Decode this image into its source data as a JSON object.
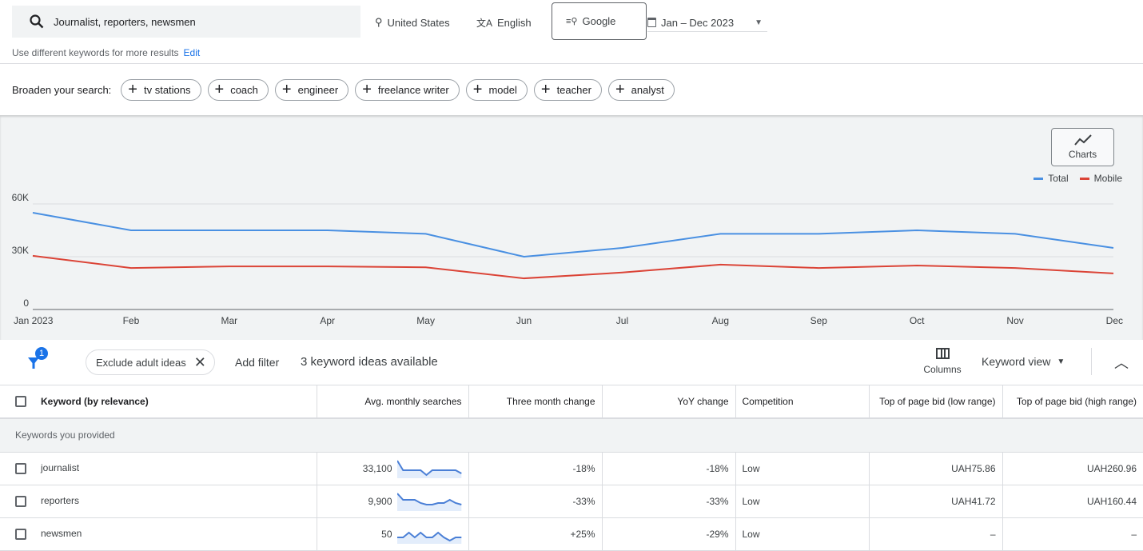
{
  "search": {
    "query": "Journalist, reporters, newsmen",
    "icon": "search-icon"
  },
  "location": "United States",
  "language": "English",
  "network": "Google",
  "date_range": "Jan – Dec 2023",
  "hint": "Use different keywords for more results",
  "edit": "Edit",
  "broaden": {
    "label": "Broaden your search:",
    "chips": [
      "tv stations",
      "coach",
      "engineer",
      "freelance writer",
      "model",
      "teacher",
      "analyst"
    ]
  },
  "charts_button": "Charts",
  "chart_data": {
    "type": "line",
    "categories": [
      "Jan 2023",
      "Feb",
      "Mar",
      "Apr",
      "May",
      "Jun",
      "Jul",
      "Aug",
      "Sep",
      "Oct",
      "Nov",
      "Dec"
    ],
    "yticks": [
      "0",
      "30K",
      "60K"
    ],
    "ylim": [
      0,
      60000
    ],
    "grid": true,
    "legend": "top-right",
    "series": [
      {
        "name": "Total",
        "color": "#4a90e2",
        "values": [
          55000,
          45000,
          45000,
          45000,
          43000,
          30000,
          35000,
          43000,
          43000,
          45000,
          43000,
          35000
        ]
      },
      {
        "name": "Mobile",
        "color": "#db4437",
        "values": [
          30500,
          23600,
          24500,
          24500,
          24000,
          17700,
          21000,
          25500,
          23600,
          25000,
          23600,
          20500
        ]
      }
    ]
  },
  "filters": {
    "badge": "1",
    "chip": "Exclude adult ideas",
    "add_filter": "Add filter",
    "count": "3 keyword ideas available",
    "columns": "Columns",
    "view": "Keyword view"
  },
  "table": {
    "headers": [
      "Keyword (by relevance)",
      "Avg. monthly searches",
      "Three month change",
      "YoY change",
      "Competition",
      "Top of page bid (low range)",
      "Top of page bid (high range)"
    ],
    "group": "Keywords you provided",
    "rows": [
      {
        "keyword": "journalist",
        "searches": "33,100",
        "three": "-18%",
        "yoy": "-18%",
        "comp": "Low",
        "low": "UAH75.86",
        "high": "UAH260.96",
        "trend": [
          10,
          4,
          4,
          4,
          4,
          1,
          4,
          4,
          4,
          4,
          4,
          2
        ]
      },
      {
        "keyword": "reporters",
        "searches": "9,900",
        "three": "-33%",
        "yoy": "-33%",
        "comp": "Low",
        "low": "UAH41.72",
        "high": "UAH160.44",
        "trend": [
          10,
          6,
          6,
          6,
          4,
          3,
          3,
          4,
          4,
          6,
          4,
          3
        ]
      },
      {
        "keyword": "newsmen",
        "searches": "50",
        "three": "+25%",
        "yoy": "-29%",
        "comp": "Low",
        "low": "–",
        "high": "–",
        "trend": [
          3,
          3,
          6,
          3,
          6,
          3,
          3,
          6,
          3,
          1,
          3,
          3
        ]
      }
    ]
  }
}
